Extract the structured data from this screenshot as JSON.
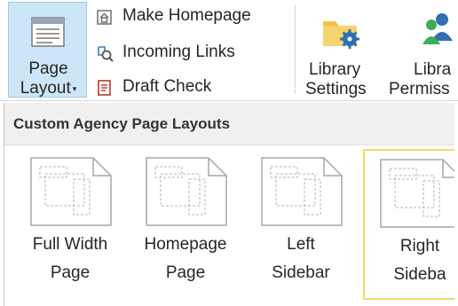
{
  "ribbon": {
    "page_layout": {
      "line1": "Page",
      "line2": "Layout",
      "caret": "▾"
    },
    "commands": [
      {
        "label": "Make Homepage",
        "icon": "homepage-icon"
      },
      {
        "label": "Incoming Links",
        "icon": "incoming-links-icon"
      },
      {
        "label": "Draft Check",
        "icon": "draft-check-icon"
      }
    ],
    "library_settings": {
      "line1": "Library",
      "line2": "Settings",
      "icon": "library-settings-icon"
    },
    "library_permissions": {
      "line1": "Libra",
      "line2": "Permiss",
      "icon": "library-permissions-icon"
    }
  },
  "dropdown": {
    "header": "Custom Agency Page Layouts",
    "layouts": [
      {
        "line1": "Full Width",
        "line2": "Page",
        "icon": "page-layout-thumbnail-icon"
      },
      {
        "line1": "Homepage",
        "line2": "Page",
        "icon": "page-layout-thumbnail-icon"
      },
      {
        "line1": "Left",
        "line2": "Sidebar",
        "icon": "page-layout-thumbnail-icon"
      },
      {
        "line1": "Right",
        "line2": "Sideba",
        "icon": "page-layout-thumbnail-icon",
        "selected": true
      }
    ]
  },
  "colors": {
    "selected_button_bg": "#cde6f7",
    "selected_item_border": "#f7d96a",
    "header_bg": "#f0f0f0"
  }
}
